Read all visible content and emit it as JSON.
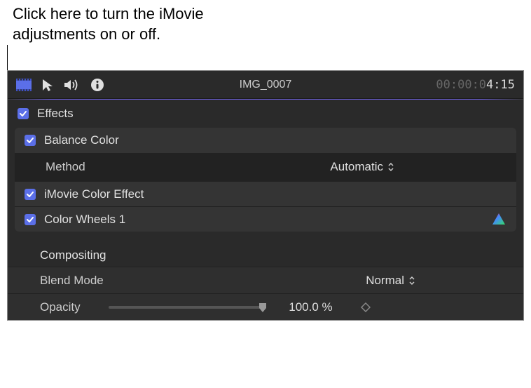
{
  "callout": {
    "text_line1": "Click here to turn the iMovie",
    "text_line2": "adjustments on or off."
  },
  "toolbar": {
    "clip_name": "IMG_0007",
    "timecode_dim": "00:00:0",
    "timecode_bright": "4:15"
  },
  "effects": {
    "header": "Effects",
    "balance_color": {
      "label": "Balance Color",
      "method_label": "Method",
      "method_value": "Automatic"
    },
    "imovie_color_effect": {
      "label": "iMovie Color Effect"
    },
    "color_wheels": {
      "label": "Color Wheels 1"
    }
  },
  "compositing": {
    "header": "Compositing",
    "blend_mode": {
      "label": "Blend Mode",
      "value": "Normal"
    },
    "opacity": {
      "label": "Opacity",
      "value": "100.0 %"
    }
  }
}
